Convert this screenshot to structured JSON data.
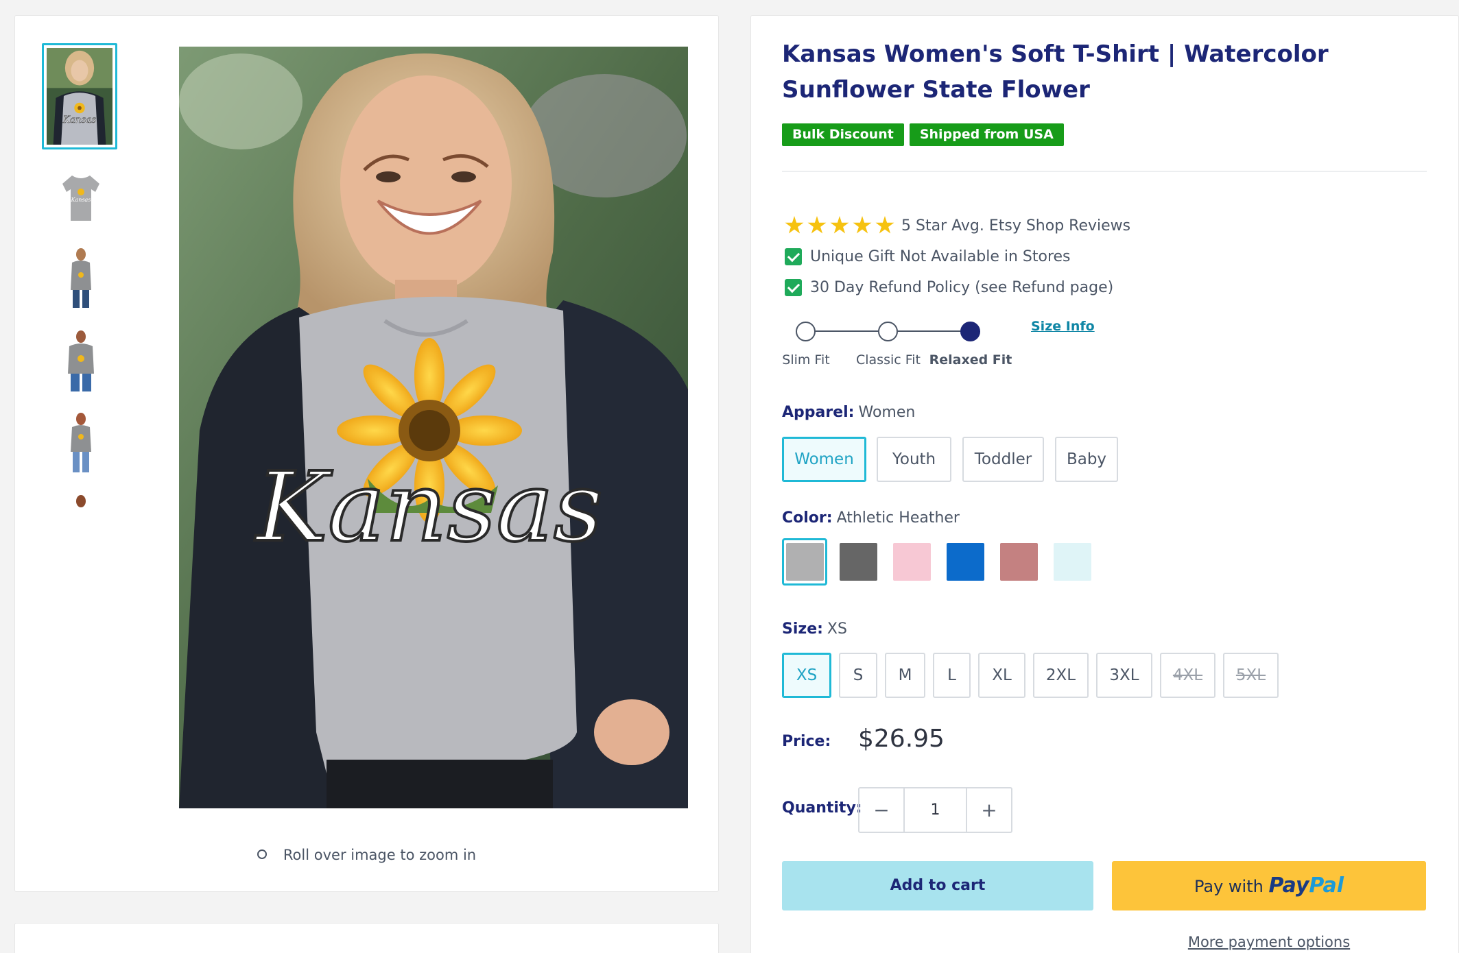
{
  "product": {
    "title": "Kansas Women's Soft T-Shirt | Watercolor Sunflower State Flower",
    "badges": [
      "Bulk Discount",
      "Shipped from USA"
    ],
    "features": {
      "rating": "5 Star Avg. Etsy Shop Reviews",
      "gift": "Unique Gift Not Available in Stores",
      "refund": "30 Day Refund Policy (see Refund page)"
    },
    "fit": {
      "options": [
        "Slim Fit",
        "Classic Fit",
        "Relaxed Fit"
      ],
      "selected": "Relaxed Fit",
      "size_info": "Size Info"
    },
    "apparel": {
      "label": "Apparel:",
      "value": "Women",
      "options": [
        "Women",
        "Youth",
        "Toddler",
        "Baby"
      ]
    },
    "color": {
      "label": "Color:",
      "value": "Athletic Heather",
      "swatches": [
        "#b0b0b1",
        "#666666",
        "#f7c8d4",
        "#0c6bcb",
        "#c48181",
        "#dff4f7"
      ]
    },
    "size": {
      "label": "Size:",
      "value": "XS",
      "options": [
        "XS",
        "S",
        "M",
        "L",
        "XL",
        "2XL",
        "3XL",
        "4XL",
        "5XL"
      ],
      "unavailable": [
        "4XL",
        "5XL"
      ]
    },
    "price": {
      "label": "Price:",
      "value": "$26.95"
    },
    "quantity": {
      "label": "Quantity:",
      "value": "1",
      "minus": "−",
      "plus": "+"
    },
    "buttons": {
      "add_to_cart": "Add to cart",
      "pay_with": "Pay with",
      "paypal_a": "Pay",
      "paypal_b": "Pal",
      "more_payment": "More payment options"
    }
  },
  "gallery": {
    "zoom_hint": "Roll over image to zoom in",
    "main_shirt_text": "Kansas"
  },
  "colors": {
    "accent": "#1fb9d6",
    "navy": "#1c2676",
    "badge_green": "#179c19",
    "paypal_yellow": "#fdc43a",
    "cart_blue": "#a8e3ee"
  }
}
